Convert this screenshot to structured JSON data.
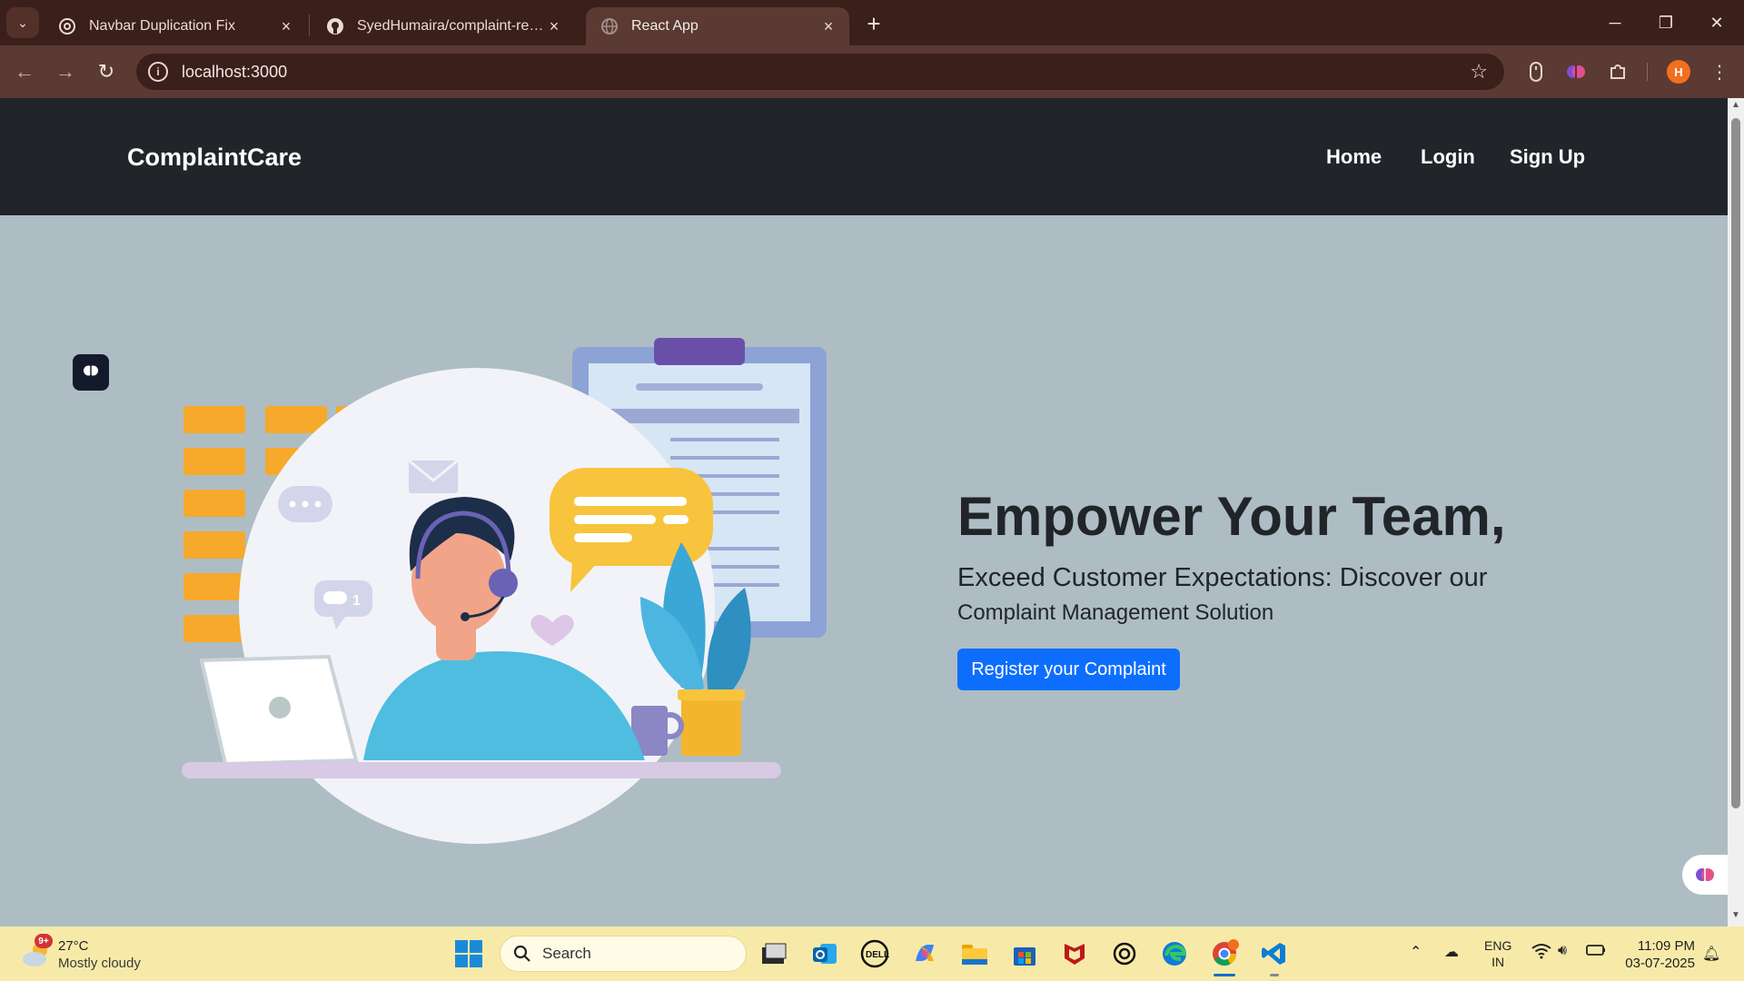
{
  "browser": {
    "tabs": [
      {
        "title": "Navbar Duplication Fix",
        "favicon": "openai-icon",
        "active": false
      },
      {
        "title": "SyedHumaira/complaint-registe",
        "favicon": "github-icon",
        "active": false
      },
      {
        "title": "React App",
        "favicon": "globe-icon",
        "active": true
      }
    ],
    "url": "localhost:3000",
    "profile_initial": "H"
  },
  "navbar": {
    "brand": "ComplaintCare",
    "links": [
      "Home",
      "Login",
      "Sign Up"
    ]
  },
  "hero": {
    "title": "Empower Your Team,",
    "subtitle_line1": "Exceed Customer Expectations: Discover our",
    "subtitle_line2": "Complaint Management Solution",
    "cta_label": "Register your Complaint",
    "illustration": "customer-support-agent-illustration",
    "speech_badge_count": "1"
  },
  "taskbar": {
    "weather": {
      "badge": "9+",
      "temp": "27°C",
      "condition": "Mostly cloudy"
    },
    "search_placeholder": "Search",
    "apps": [
      "task-view",
      "outlook",
      "dell",
      "copilot",
      "file-explorer",
      "microsoft-store",
      "mcafee",
      "chatgpt",
      "edge",
      "chrome",
      "vscode"
    ],
    "language": {
      "line1": "ENG",
      "line2": "IN"
    },
    "time": "11:09 PM",
    "date": "03-07-2025"
  },
  "colors": {
    "nav_bg": "#212529",
    "hero_bg": "#aebdc3",
    "cta_bg": "#0d6efd",
    "chrome_frame": "#3b1f1b",
    "chrome_toolbar": "#5a3a33",
    "taskbar_bg": "#f7eaa9"
  }
}
